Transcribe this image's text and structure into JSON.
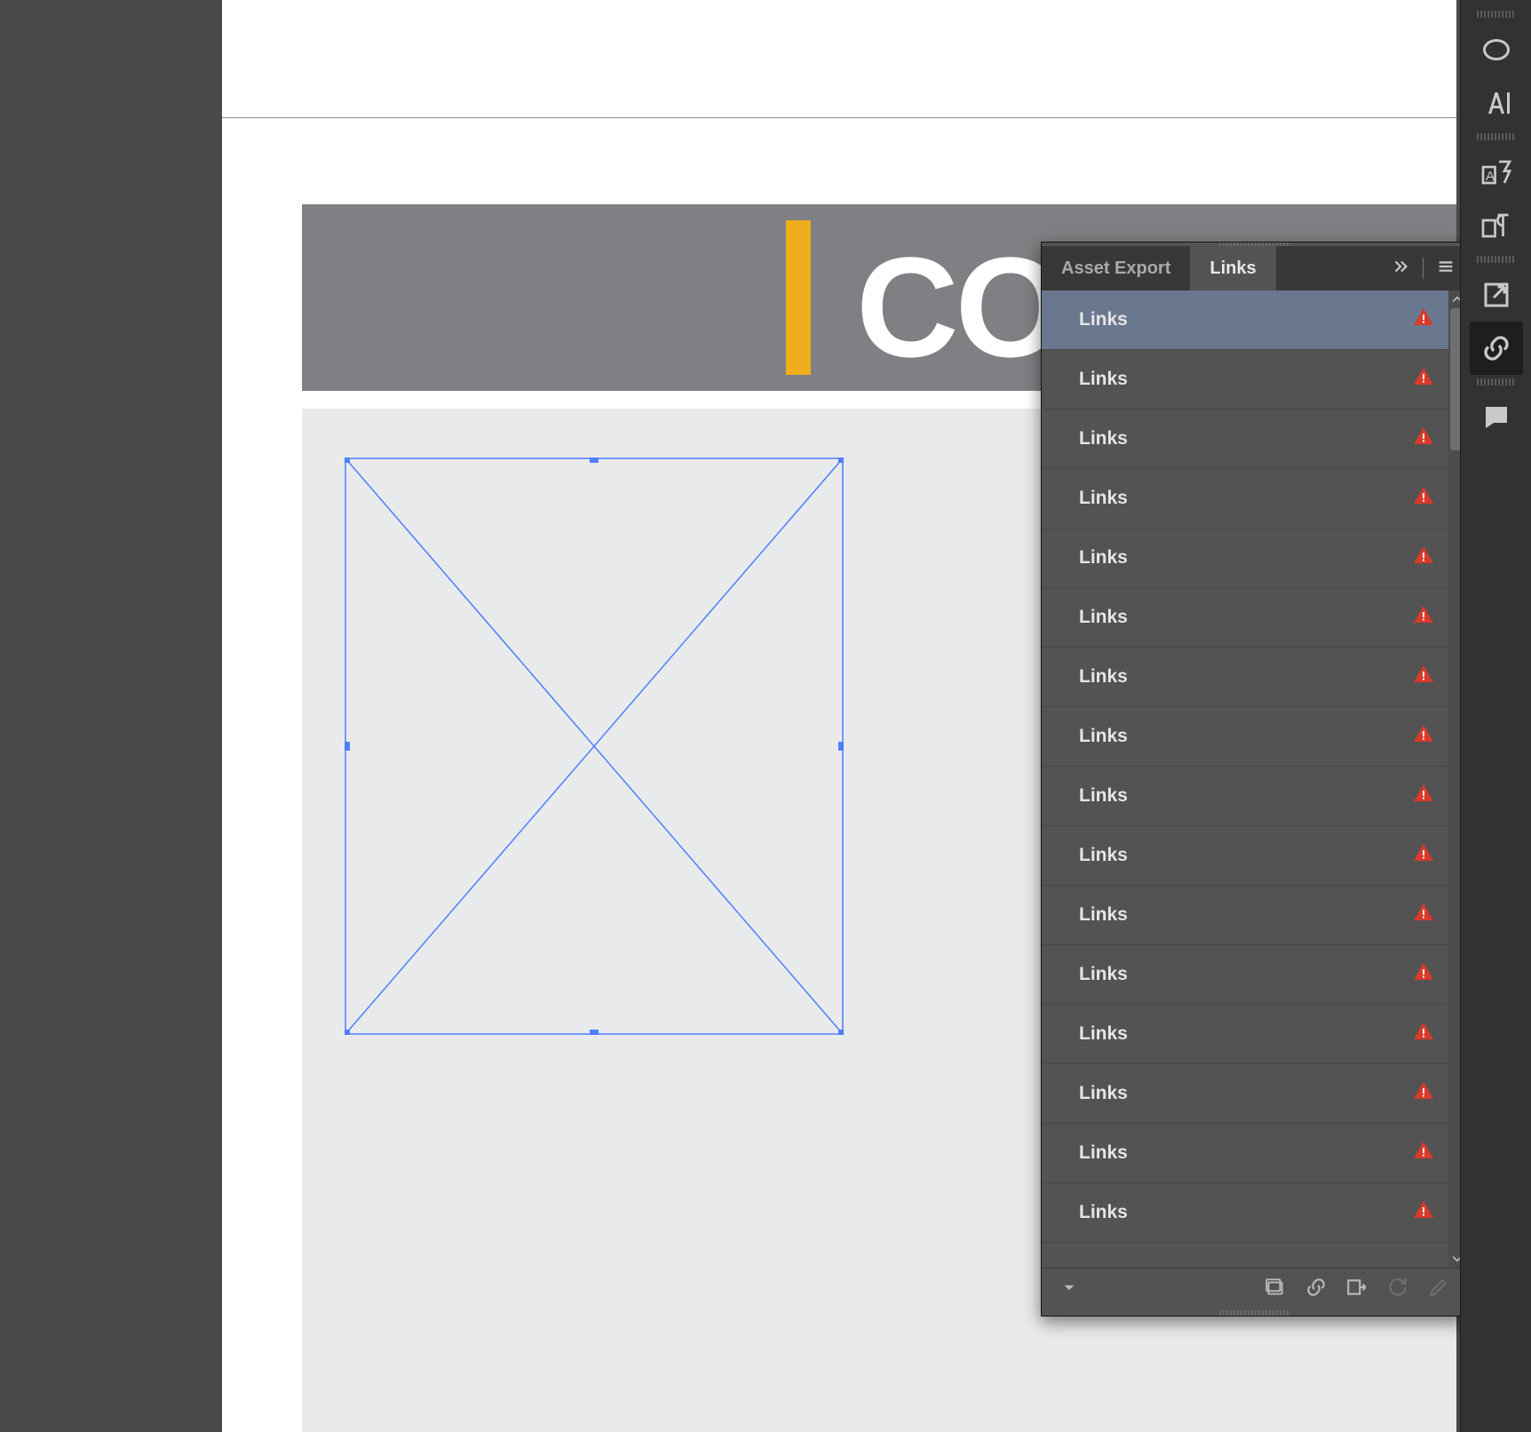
{
  "doc": {
    "header_text": "CONS"
  },
  "panel": {
    "tabs": {
      "asset_export": "Asset Export",
      "links": "Links"
    },
    "links": [
      {
        "name": "Links",
        "status": "missing",
        "selected": true
      },
      {
        "name": "Links",
        "status": "missing",
        "selected": false
      },
      {
        "name": "Links",
        "status": "missing",
        "selected": false
      },
      {
        "name": "Links",
        "status": "missing",
        "selected": false
      },
      {
        "name": "Links",
        "status": "missing",
        "selected": false
      },
      {
        "name": "Links",
        "status": "missing",
        "selected": false
      },
      {
        "name": "Links",
        "status": "missing",
        "selected": false
      },
      {
        "name": "Links",
        "status": "missing",
        "selected": false
      },
      {
        "name": "Links",
        "status": "missing",
        "selected": false
      },
      {
        "name": "Links",
        "status": "missing",
        "selected": false
      },
      {
        "name": "Links",
        "status": "missing",
        "selected": false
      },
      {
        "name": "Links",
        "status": "missing",
        "selected": false
      },
      {
        "name": "Links",
        "status": "missing",
        "selected": false
      },
      {
        "name": "Links",
        "status": "missing",
        "selected": false
      },
      {
        "name": "Links",
        "status": "missing",
        "selected": false
      },
      {
        "name": "Links",
        "status": "missing",
        "selected": false
      }
    ]
  },
  "rail": {
    "icons": [
      "opentype",
      "character",
      "glyphs",
      "paragraph-styles",
      "export",
      "links",
      "comments"
    ]
  }
}
